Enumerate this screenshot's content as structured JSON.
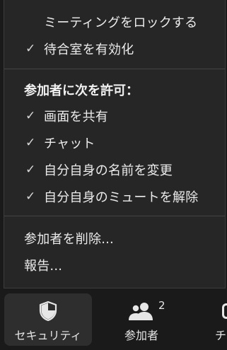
{
  "menu": {
    "lock_meeting": "ミーティングをロックする",
    "waiting_room": "待合室を有効化",
    "allow_heading": "参加者に次を許可：",
    "allow_items": [
      "画面を共有",
      "チャット",
      "自分自身の名前を変更",
      "自分自身のミュートを解除"
    ],
    "remove_participant": "参加者を削除...",
    "report": "報告...",
    "check_glyph": "✓"
  },
  "toolbar": {
    "security_label": "セキュリティ",
    "participants_label": "参加者",
    "participants_count": "2",
    "chat_label_partial": "チ"
  },
  "colors": {
    "menu_bg": "#262626",
    "page_bg": "#1a1a1a",
    "active_button_bg": "#2e2e2e",
    "text": "#ececec"
  }
}
